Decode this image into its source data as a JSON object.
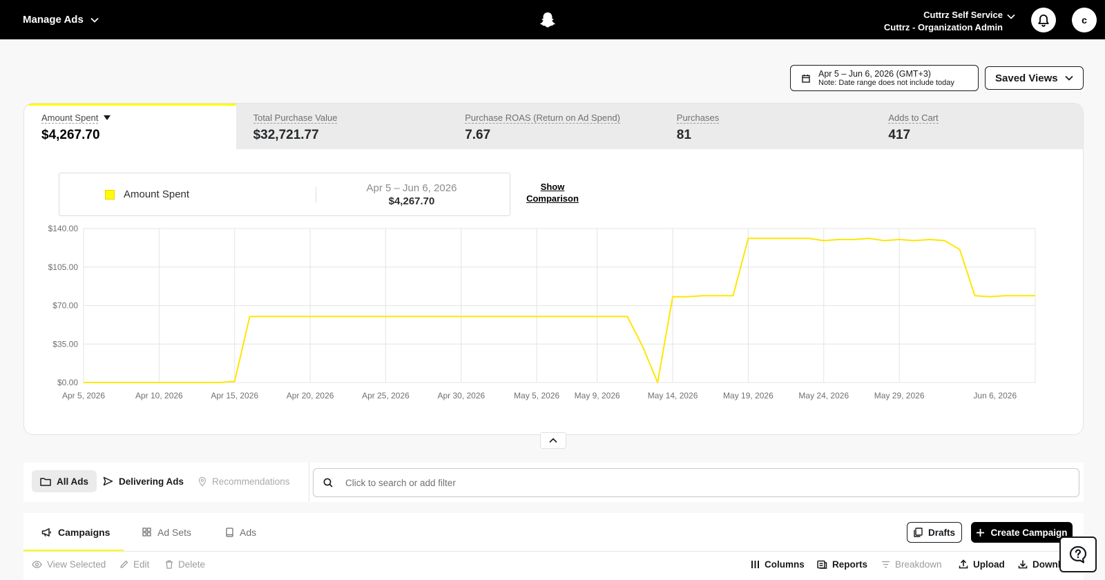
{
  "header": {
    "app_menu_label": "Manage Ads",
    "org_name": "Cuttrz Self Service",
    "org_role": "Cuttrz - Organization Admin",
    "avatar_letter": "c"
  },
  "date_range": {
    "label": "Apr 5 – Jun 6, 2026 (GMT+3)",
    "note": "Note: Date range does not include today"
  },
  "saved_views_label": "Saved Views",
  "metrics": [
    {
      "label": "Amount Spent",
      "value": "$4,267.70",
      "active": true
    },
    {
      "label": "Total Purchase Value",
      "value": "$32,721.77"
    },
    {
      "label": "Purchase ROAS (Return on Ad Spend)",
      "value": "7.67"
    },
    {
      "label": "Purchases",
      "value": "81"
    },
    {
      "label": "Adds to Cart",
      "value": "417"
    }
  ],
  "legend": {
    "series_name": "Amount Spent",
    "range": "Apr 5 – Jun 6, 2026",
    "total": "$4,267.70",
    "show_comparison_line1": "Show",
    "show_comparison_line2": "Comparison"
  },
  "chart_data": {
    "type": "line",
    "ylim": [
      0,
      140
    ],
    "y_ticks": [
      "$0.00",
      "$35.00",
      "$70.00",
      "$105.00",
      "$140.00"
    ],
    "x_tick_labels": [
      "Apr 5, 2026",
      "Apr 10, 2026",
      "Apr 15, 2026",
      "Apr 20, 2026",
      "Apr 25, 2026",
      "Apr 30, 2026",
      "May 5, 2026",
      "May 9, 2026",
      "May 14, 2026",
      "May 19, 2026",
      "May 24, 2026",
      "May 29, 2026",
      "Jun 6, 2026"
    ],
    "color": "#fffc00",
    "series": [
      {
        "name": "Amount Spent",
        "values": [
          0,
          0,
          0,
          0,
          0,
          0,
          0,
          0,
          0,
          0,
          1,
          60,
          60,
          60,
          60,
          60,
          60,
          60,
          60,
          60,
          60,
          60,
          60,
          60,
          60,
          60,
          60,
          60,
          60,
          60,
          60,
          60,
          60,
          60,
          60,
          60,
          60,
          33,
          0,
          78,
          78,
          79,
          79,
          79,
          131,
          131,
          131,
          131,
          131,
          129,
          130,
          130,
          131,
          129,
          130,
          129,
          130,
          129,
          121,
          79,
          78,
          79,
          79,
          79
        ]
      }
    ]
  },
  "filters": {
    "all_ads": "All Ads",
    "delivering_ads": "Delivering Ads",
    "recommendations": "Recommendations",
    "search_placeholder": "Click to search or add filter"
  },
  "tabs": {
    "campaigns": "Campaigns",
    "ad_sets": "Ad Sets",
    "ads": "Ads",
    "drafts": "Drafts",
    "create_campaign": "Create Campaign"
  },
  "actions": {
    "view_selected": "View Selected",
    "edit": "Edit",
    "delete": "Delete",
    "columns": "Columns",
    "reports": "Reports",
    "breakdown": "Breakdown",
    "upload": "Upload",
    "download": "Downl"
  }
}
